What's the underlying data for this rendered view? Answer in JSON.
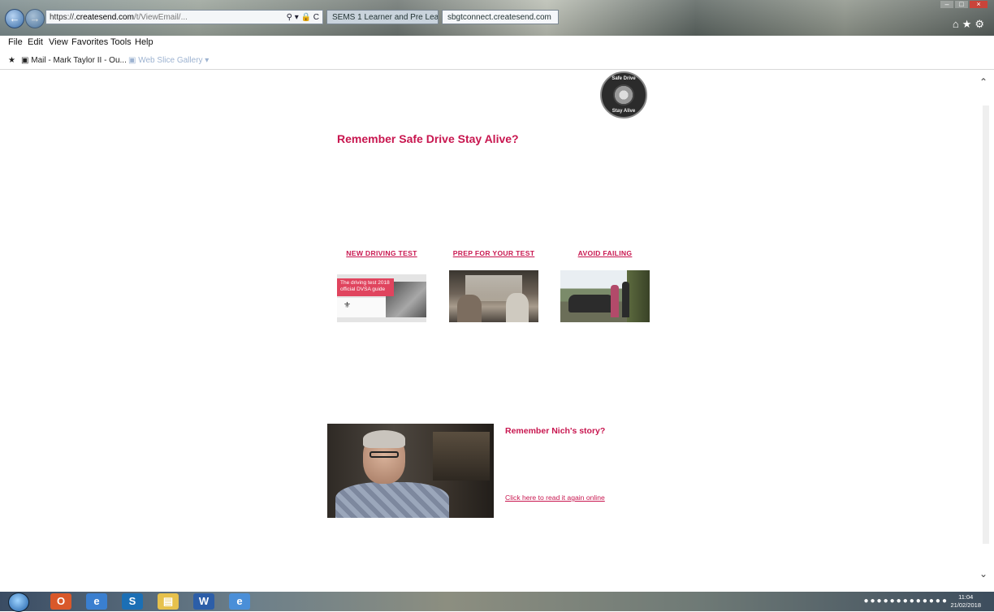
{
  "browser": {
    "address_scheme": "https://",
    "address_domain": ".createsend.com",
    "address_rest": "/t/ViewEmail/...",
    "tab1_label": "SEMS 1 Learner and Pre Learne...",
    "tab2_label": "sbgtconnect.createsend.com",
    "menu": [
      "File",
      "Edit",
      "View",
      "Favorites",
      "Tools",
      "Help"
    ],
    "favorites": {
      "item1": "Mail - Mark Taylor II - Ou...",
      "item2": "Web Slice Gallery"
    }
  },
  "logo": {
    "top_text": "Safe Drive",
    "bottom_text": "Stay Alive"
  },
  "content": {
    "headline": "Remember Safe Drive Stay Alive?",
    "columns": [
      {
        "title": "NEW DRIVING TEST",
        "thumb_caption": "The driving test 2018 official DVSA guide"
      },
      {
        "title": "PREP FOR YOUR TEST"
      },
      {
        "title": "AVOID FAILING"
      }
    ],
    "story": {
      "title": "Remember Nich's story?",
      "link": "Click here to read it again online"
    }
  },
  "taskbar": {
    "clock_time": "11:04",
    "clock_date": "21/02/2018"
  }
}
